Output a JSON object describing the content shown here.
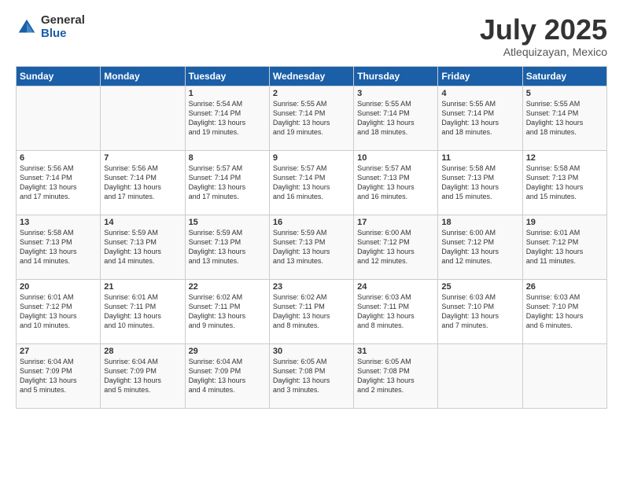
{
  "logo": {
    "general": "General",
    "blue": "Blue"
  },
  "title": "July 2025",
  "subtitle": "Atlequizayan, Mexico",
  "days_header": [
    "Sunday",
    "Monday",
    "Tuesday",
    "Wednesday",
    "Thursday",
    "Friday",
    "Saturday"
  ],
  "weeks": [
    [
      {
        "day": "",
        "text": ""
      },
      {
        "day": "",
        "text": ""
      },
      {
        "day": "1",
        "text": "Sunrise: 5:54 AM\nSunset: 7:14 PM\nDaylight: 13 hours\nand 19 minutes."
      },
      {
        "day": "2",
        "text": "Sunrise: 5:55 AM\nSunset: 7:14 PM\nDaylight: 13 hours\nand 19 minutes."
      },
      {
        "day": "3",
        "text": "Sunrise: 5:55 AM\nSunset: 7:14 PM\nDaylight: 13 hours\nand 18 minutes."
      },
      {
        "day": "4",
        "text": "Sunrise: 5:55 AM\nSunset: 7:14 PM\nDaylight: 13 hours\nand 18 minutes."
      },
      {
        "day": "5",
        "text": "Sunrise: 5:55 AM\nSunset: 7:14 PM\nDaylight: 13 hours\nand 18 minutes."
      }
    ],
    [
      {
        "day": "6",
        "text": "Sunrise: 5:56 AM\nSunset: 7:14 PM\nDaylight: 13 hours\nand 17 minutes."
      },
      {
        "day": "7",
        "text": "Sunrise: 5:56 AM\nSunset: 7:14 PM\nDaylight: 13 hours\nand 17 minutes."
      },
      {
        "day": "8",
        "text": "Sunrise: 5:57 AM\nSunset: 7:14 PM\nDaylight: 13 hours\nand 17 minutes."
      },
      {
        "day": "9",
        "text": "Sunrise: 5:57 AM\nSunset: 7:14 PM\nDaylight: 13 hours\nand 16 minutes."
      },
      {
        "day": "10",
        "text": "Sunrise: 5:57 AM\nSunset: 7:13 PM\nDaylight: 13 hours\nand 16 minutes."
      },
      {
        "day": "11",
        "text": "Sunrise: 5:58 AM\nSunset: 7:13 PM\nDaylight: 13 hours\nand 15 minutes."
      },
      {
        "day": "12",
        "text": "Sunrise: 5:58 AM\nSunset: 7:13 PM\nDaylight: 13 hours\nand 15 minutes."
      }
    ],
    [
      {
        "day": "13",
        "text": "Sunrise: 5:58 AM\nSunset: 7:13 PM\nDaylight: 13 hours\nand 14 minutes."
      },
      {
        "day": "14",
        "text": "Sunrise: 5:59 AM\nSunset: 7:13 PM\nDaylight: 13 hours\nand 14 minutes."
      },
      {
        "day": "15",
        "text": "Sunrise: 5:59 AM\nSunset: 7:13 PM\nDaylight: 13 hours\nand 13 minutes."
      },
      {
        "day": "16",
        "text": "Sunrise: 5:59 AM\nSunset: 7:13 PM\nDaylight: 13 hours\nand 13 minutes."
      },
      {
        "day": "17",
        "text": "Sunrise: 6:00 AM\nSunset: 7:12 PM\nDaylight: 13 hours\nand 12 minutes."
      },
      {
        "day": "18",
        "text": "Sunrise: 6:00 AM\nSunset: 7:12 PM\nDaylight: 13 hours\nand 12 minutes."
      },
      {
        "day": "19",
        "text": "Sunrise: 6:01 AM\nSunset: 7:12 PM\nDaylight: 13 hours\nand 11 minutes."
      }
    ],
    [
      {
        "day": "20",
        "text": "Sunrise: 6:01 AM\nSunset: 7:12 PM\nDaylight: 13 hours\nand 10 minutes."
      },
      {
        "day": "21",
        "text": "Sunrise: 6:01 AM\nSunset: 7:11 PM\nDaylight: 13 hours\nand 10 minutes."
      },
      {
        "day": "22",
        "text": "Sunrise: 6:02 AM\nSunset: 7:11 PM\nDaylight: 13 hours\nand 9 minutes."
      },
      {
        "day": "23",
        "text": "Sunrise: 6:02 AM\nSunset: 7:11 PM\nDaylight: 13 hours\nand 8 minutes."
      },
      {
        "day": "24",
        "text": "Sunrise: 6:03 AM\nSunset: 7:11 PM\nDaylight: 13 hours\nand 8 minutes."
      },
      {
        "day": "25",
        "text": "Sunrise: 6:03 AM\nSunset: 7:10 PM\nDaylight: 13 hours\nand 7 minutes."
      },
      {
        "day": "26",
        "text": "Sunrise: 6:03 AM\nSunset: 7:10 PM\nDaylight: 13 hours\nand 6 minutes."
      }
    ],
    [
      {
        "day": "27",
        "text": "Sunrise: 6:04 AM\nSunset: 7:09 PM\nDaylight: 13 hours\nand 5 minutes."
      },
      {
        "day": "28",
        "text": "Sunrise: 6:04 AM\nSunset: 7:09 PM\nDaylight: 13 hours\nand 5 minutes."
      },
      {
        "day": "29",
        "text": "Sunrise: 6:04 AM\nSunset: 7:09 PM\nDaylight: 13 hours\nand 4 minutes."
      },
      {
        "day": "30",
        "text": "Sunrise: 6:05 AM\nSunset: 7:08 PM\nDaylight: 13 hours\nand 3 minutes."
      },
      {
        "day": "31",
        "text": "Sunrise: 6:05 AM\nSunset: 7:08 PM\nDaylight: 13 hours\nand 2 minutes."
      },
      {
        "day": "",
        "text": ""
      },
      {
        "day": "",
        "text": ""
      }
    ]
  ]
}
